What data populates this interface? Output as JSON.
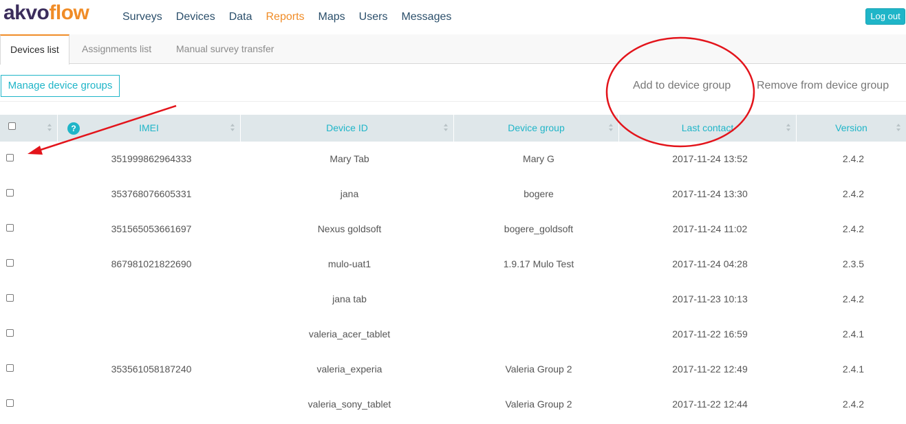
{
  "header": {
    "logo_part1": "akvo",
    "logo_part2": "flow",
    "nav": [
      "Surveys",
      "Devices",
      "Data",
      "Reports",
      "Maps",
      "Users",
      "Messages"
    ],
    "active_nav": "Reports",
    "logout_label": "Log out"
  },
  "subtabs": [
    "Devices list",
    "Assignments list",
    "Manual survey transfer"
  ],
  "toolbar": {
    "manage_label": "Manage device groups",
    "add_label": "Add to device group",
    "remove_label": "Remove from device group"
  },
  "table": {
    "columns": [
      "IMEI",
      "Device ID",
      "Device group",
      "Last contact",
      "Version"
    ],
    "help_glyph": "?",
    "rows": [
      {
        "imei": "351999862964333",
        "device_id": "Mary Tab",
        "group": "Mary G",
        "last_contact": "2017-11-24 13:52",
        "version": "2.4.2"
      },
      {
        "imei": "353768076605331",
        "device_id": "jana",
        "group": "bogere",
        "last_contact": "2017-11-24 13:30",
        "version": "2.4.2"
      },
      {
        "imei": "351565053661697",
        "device_id": "Nexus goldsoft",
        "group": "bogere_goldsoft",
        "last_contact": "2017-11-24 11:02",
        "version": "2.4.2"
      },
      {
        "imei": "867981021822690",
        "device_id": "mulo-uat1",
        "group": "1.9.17 Mulo Test",
        "last_contact": "2017-11-24 04:28",
        "version": "2.3.5"
      },
      {
        "imei": "",
        "device_id": "jana tab",
        "group": "",
        "last_contact": "2017-11-23 10:13",
        "version": "2.4.2"
      },
      {
        "imei": "",
        "device_id": "valeria_acer_tablet",
        "group": "",
        "last_contact": "2017-11-22 16:59",
        "version": "2.4.1"
      },
      {
        "imei": "353561058187240",
        "device_id": "valeria_experia",
        "group": "Valeria Group 2",
        "last_contact": "2017-11-22 12:49",
        "version": "2.4.1"
      },
      {
        "imei": "",
        "device_id": "valeria_sony_tablet",
        "group": "Valeria Group 2",
        "last_contact": "2017-11-22 12:44",
        "version": "2.4.2"
      }
    ]
  },
  "colors": {
    "accent": "#1fb5c8",
    "brand_orange": "#f08c27",
    "brand_purple": "#3b2d5c",
    "annotation_red": "#e3141b"
  }
}
